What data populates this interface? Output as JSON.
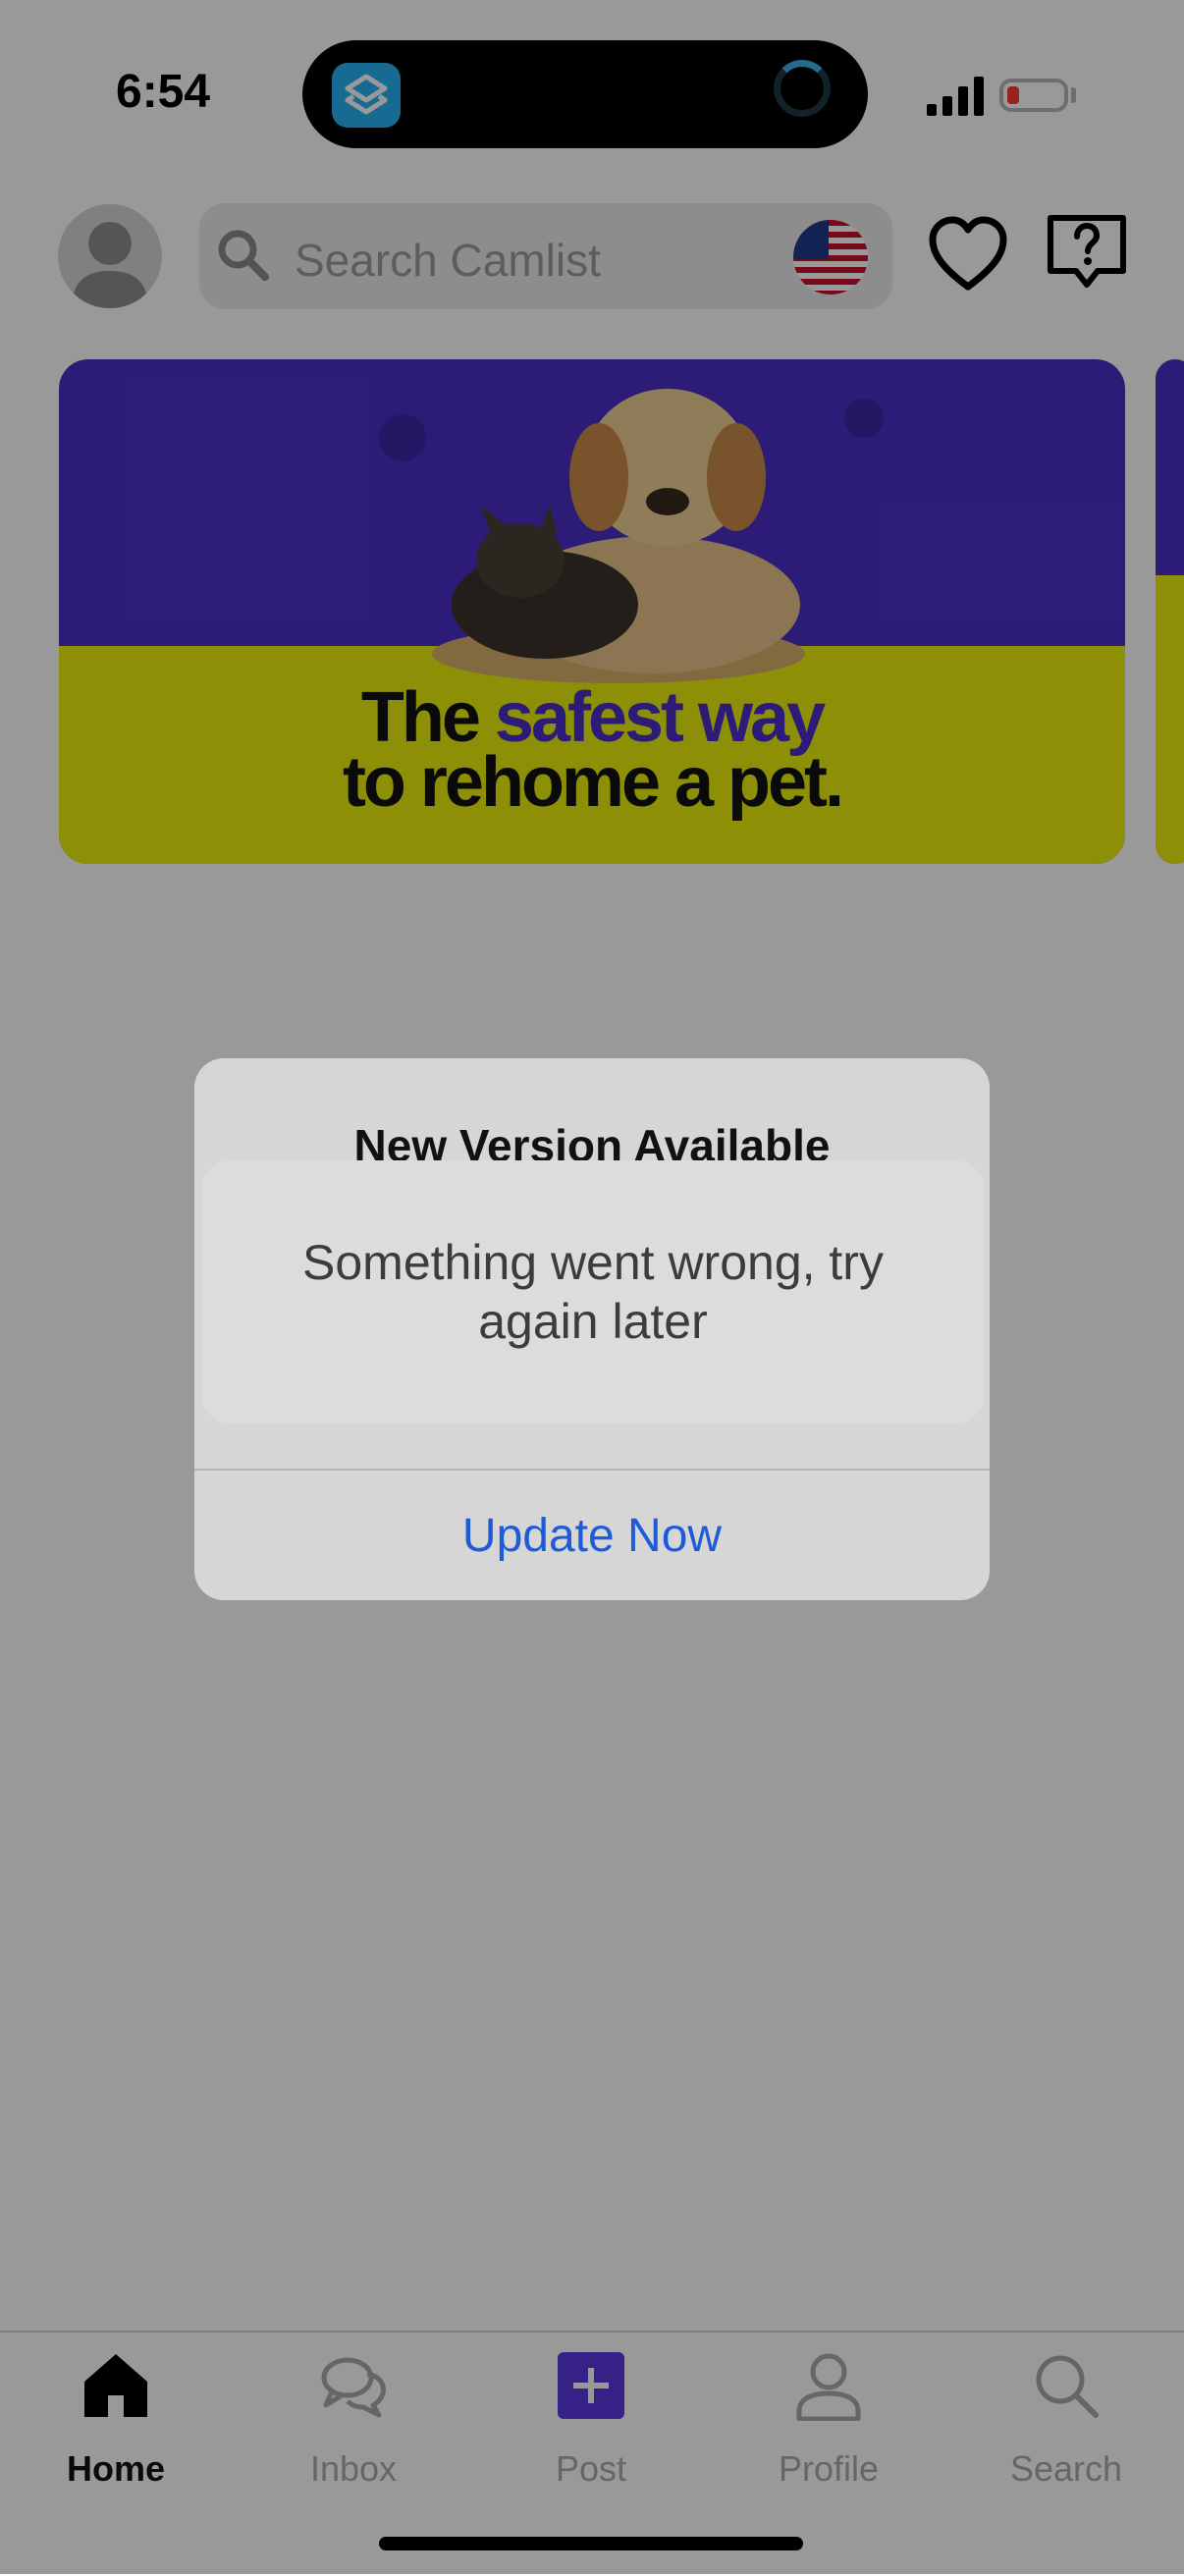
{
  "status_bar": {
    "time": "6:54",
    "island_app_icon": "shortcuts-icon",
    "battery_level": 0.15
  },
  "header": {
    "search_placeholder": "Search Camlist",
    "avatar_icon": "person-avatar-icon",
    "flag_icon": "us-flag-icon",
    "favorites_icon": "heart-icon",
    "help_icon": "help-bubble-icon"
  },
  "banner": {
    "headline_plain": "The ",
    "headline_accent": "safest way",
    "headline_line2": "to rehome a pet.",
    "colors": {
      "purple": "#4a30c8",
      "yellow": "#ebee0a"
    }
  },
  "alert": {
    "title": "New Version Available",
    "button_label": "Update Now",
    "button_color": "#1e5bd8"
  },
  "toast": {
    "message": "Something went wrong, try again later"
  },
  "tab_bar": {
    "tabs": [
      {
        "label": "Home",
        "icon": "home-icon",
        "active": true
      },
      {
        "label": "Inbox",
        "icon": "chat-bubbles-icon",
        "active": false
      },
      {
        "label": "Post",
        "icon": "plus-square-icon",
        "active": false
      },
      {
        "label": "Profile",
        "icon": "person-icon",
        "active": false
      },
      {
        "label": "Search",
        "icon": "search-icon",
        "active": false
      }
    ]
  }
}
